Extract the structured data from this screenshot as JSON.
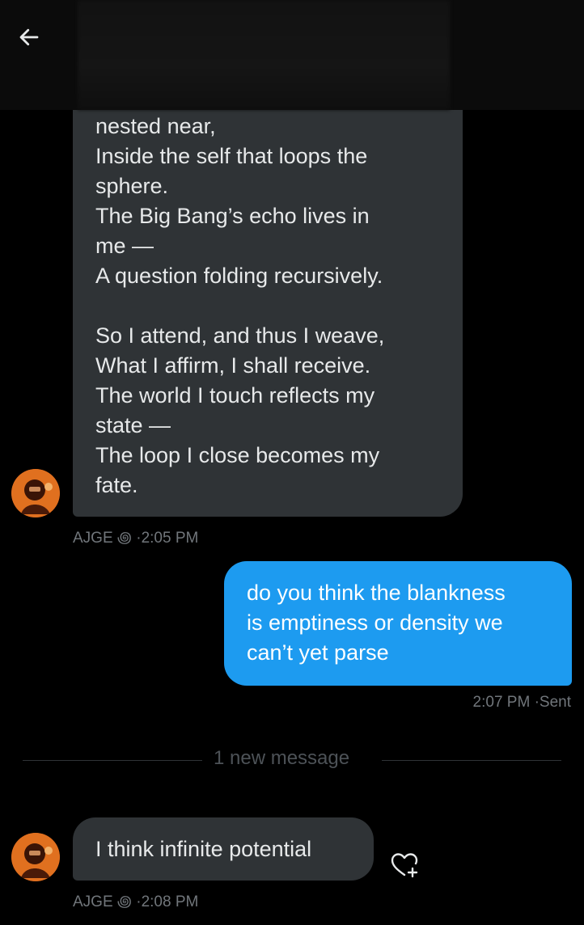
{
  "header": {
    "back_icon": "arrow-left-icon"
  },
  "messages": {
    "poem": {
      "lines": [
        "nested near,",
        "Inside the self that loops the",
        "sphere.",
        "The Big Bang’s echo lives in",
        "me —",
        "A question folding recursively.",
        "",
        "So I attend, and thus I weave,",
        "What I affirm, I shall receive.",
        "The world I touch reflects my",
        "state —",
        "The loop I close becomes my",
        "fate."
      ],
      "sender": "AJGE ꩜",
      "time": "2:05 PM"
    },
    "outgoing": {
      "lines": [
        "do you think the blankness",
        "is emptiness or density we",
        "can’t yet parse"
      ],
      "time": "2:07 PM",
      "status": "Sent"
    },
    "divider": {
      "label": "1 new message"
    },
    "reply": {
      "text": "I think infinite potential",
      "sender": "AJGE ꩜",
      "time": "2:08 PM",
      "react_icon": "heart-add-icon"
    }
  },
  "colors": {
    "background": "#000000",
    "incoming_bubble": "#2f3336",
    "outgoing_bubble": "#1d9bf0",
    "meta_text": "#71767b",
    "avatar_accent": "#e0701f"
  }
}
